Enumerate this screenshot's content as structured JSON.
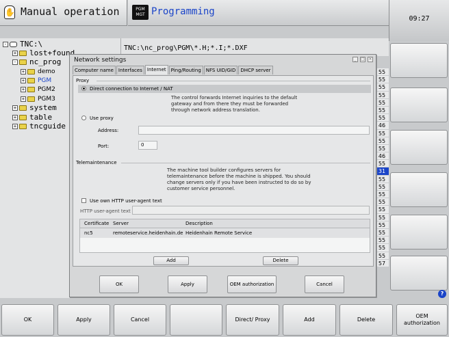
{
  "header": {
    "mode_title": "Manual operation",
    "pgm_badge_line1": "PGM",
    "pgm_badge_line2": "MGT",
    "program_title": "Programming",
    "clock": "09:27"
  },
  "tree": {
    "root": "TNC:\\",
    "items": [
      {
        "label": "lost+found",
        "expander": "+"
      },
      {
        "label": "nc_prog",
        "expander": "-"
      },
      {
        "label": "demo",
        "expander": "+"
      },
      {
        "label": "PGM",
        "expander": "+"
      },
      {
        "label": "PGM2",
        "expander": "+"
      },
      {
        "label": "PGM3",
        "expander": "+"
      },
      {
        "label": "system",
        "expander": "+"
      },
      {
        "label": "table",
        "expander": "+"
      },
      {
        "label": "tncguide",
        "expander": "+"
      }
    ]
  },
  "path": "TNC:\\nc_prog\\PGM\\*.H;*.I;*.DXF",
  "numbers": [
    "55",
    "55",
    "55",
    "55",
    "55",
    "55",
    "55",
    "46",
    "55",
    "55",
    "55",
    "46",
    "55",
    "31",
    "55",
    "55",
    "55",
    "55",
    "55",
    "55",
    "55",
    "55",
    "55",
    "55",
    "55",
    "57"
  ],
  "dialog": {
    "title": "Network settings",
    "tabs": [
      "Computer name",
      "Interfaces",
      "Internet",
      "Ping/Routing",
      "NFS UID/GID",
      "DHCP server"
    ],
    "proxy_group": "Proxy",
    "direct_option": "Direct connection to Internet / NAT",
    "direct_info": "The control forwards Internet inquiries to the default gateway and from there they must be forwarded through network address translation.",
    "use_proxy_option": "Use proxy",
    "address_label": "Address:",
    "address_value": "",
    "port_label": "Port:",
    "port_value": "0",
    "tele_group": "Telemaintenance",
    "tele_info": "The machine tool builder configures servers for telemaintenance before the machine is shipped. You should change servers only if you have been instructed to do so by customer service personnel.",
    "http_checkbox": "Use own HTTP user-agent text",
    "http_label": "HTTP user-agent text",
    "table": {
      "headers": [
        "Certificate",
        "Server",
        "Description"
      ],
      "rows": [
        [
          "nc5",
          "remoteservice.heidenhain.de",
          "Heidenhain Remote Service"
        ]
      ]
    },
    "add_label": "Add",
    "delete_label": "Delete",
    "ok_label": "OK",
    "apply_label": "Apply",
    "oem_label": "OEM authorization",
    "cancel_label": "Cancel"
  },
  "softkeys": [
    "OK",
    "Apply",
    "Cancel",
    "",
    "Direct/ Proxy",
    "Add",
    "Delete",
    "OEM authorization"
  ],
  "colors": {
    "accent": "#1a44c8",
    "folder": "#e9d24a",
    "panel": "#e6e7e8"
  }
}
